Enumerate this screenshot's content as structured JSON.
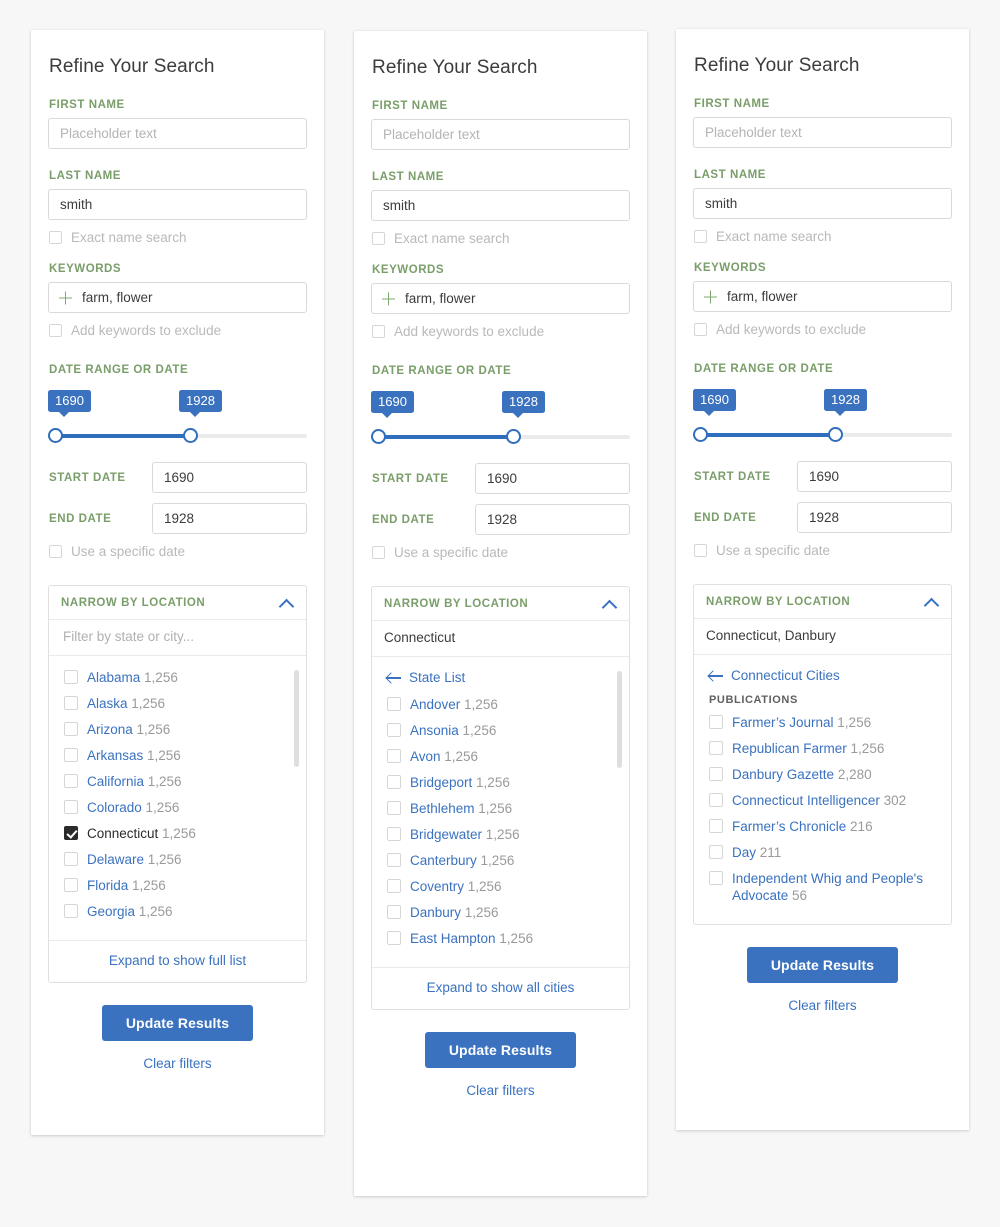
{
  "colors": {
    "accent_blue": "#3a72c0",
    "label_green": "#7a9e6a",
    "checked_box": "#2b2b2b",
    "count_gray": "#9a9a9a",
    "page_bg": "#f7f7f7"
  },
  "common": {
    "title": "Refine Your Search",
    "first_name_label": "FIRST NAME",
    "first_name_value": "",
    "first_name_placeholder": "Placeholder text",
    "last_name_label": "LAST NAME",
    "last_name_value": "smith",
    "last_name_placeholder": "",
    "exact_name_label": "Exact name search",
    "keywords_label": "KEYWORDS",
    "keywords_value": "farm, flower",
    "keywords_placeholder": "",
    "exclude_keywords_label": "Add keywords to exclude",
    "date_range_label": "DATE RANGE OR DATE",
    "slider_min_bubble": "1690",
    "slider_max_bubble": "1928",
    "start_date_label": "START DATE",
    "start_date_value": "1690",
    "end_date_label": "END DATE",
    "end_date_value": "1928",
    "specific_date_label": "Use a specific date",
    "narrow_by_location_label": "NARROW BY LOCATION",
    "update_results_label": "Update Results",
    "clear_filters_label": "Clear filters",
    "plus_icon": "plus-icon",
    "chevron_up_icon": "chevron-up-icon",
    "arrow_left_icon": "arrow-left-icon"
  },
  "panel1": {
    "location_filter_placeholder": "Filter by state or city...",
    "location_filter_value": "",
    "expand_label": "Expand to show full list",
    "items": [
      {
        "label": "Alabama",
        "count": "1,256",
        "checked": false
      },
      {
        "label": "Alaska",
        "count": "1,256",
        "checked": false
      },
      {
        "label": "Arizona",
        "count": "1,256",
        "checked": false
      },
      {
        "label": "Arkansas",
        "count": "1,256",
        "checked": false
      },
      {
        "label": "California",
        "count": "1,256",
        "checked": false
      },
      {
        "label": "Colorado",
        "count": "1,256",
        "checked": false
      },
      {
        "label": "Connecticut",
        "count": "1,256",
        "checked": true
      },
      {
        "label": "Delaware",
        "count": "1,256",
        "checked": false
      },
      {
        "label": "Florida",
        "count": "1,256",
        "checked": false
      },
      {
        "label": "Georgia",
        "count": "1,256",
        "checked": false
      }
    ]
  },
  "panel2": {
    "location_filter_value": "Connecticut",
    "back_link_label": "State List",
    "expand_label": "Expand to show all cities",
    "items": [
      {
        "label": "Andover",
        "count": "1,256",
        "checked": false
      },
      {
        "label": "Ansonia",
        "count": "1,256",
        "checked": false
      },
      {
        "label": "Avon",
        "count": "1,256",
        "checked": false
      },
      {
        "label": "Bridgeport",
        "count": "1,256",
        "checked": false
      },
      {
        "label": "Bethlehem",
        "count": "1,256",
        "checked": false
      },
      {
        "label": "Bridgewater",
        "count": "1,256",
        "checked": false
      },
      {
        "label": "Canterbury",
        "count": "1,256",
        "checked": false
      },
      {
        "label": "Coventry",
        "count": "1,256",
        "checked": false
      },
      {
        "label": "Danbury",
        "count": "1,256",
        "checked": false
      },
      {
        "label": "East Hampton",
        "count": "1,256",
        "checked": false
      }
    ]
  },
  "panel3": {
    "location_filter_value": "Connecticut, Danbury",
    "back_link_label": "Connecticut Cities",
    "publications_heading": "PUBLICATIONS",
    "items": [
      {
        "label": "Farmer’s Journal",
        "count": "1,256",
        "checked": false
      },
      {
        "label": "Republican Farmer",
        "count": "1,256",
        "checked": false
      },
      {
        "label": "Danbury Gazette",
        "count": "2,280",
        "checked": false
      },
      {
        "label": "Connecticut Intelligencer",
        "count": "302",
        "checked": false
      },
      {
        "label": "Farmer’s Chronicle",
        "count": "216",
        "checked": false
      },
      {
        "label": "Day",
        "count": "211",
        "checked": false
      },
      {
        "label": "Independent Whig and People's Advocate",
        "count": "56",
        "checked": false
      }
    ]
  }
}
